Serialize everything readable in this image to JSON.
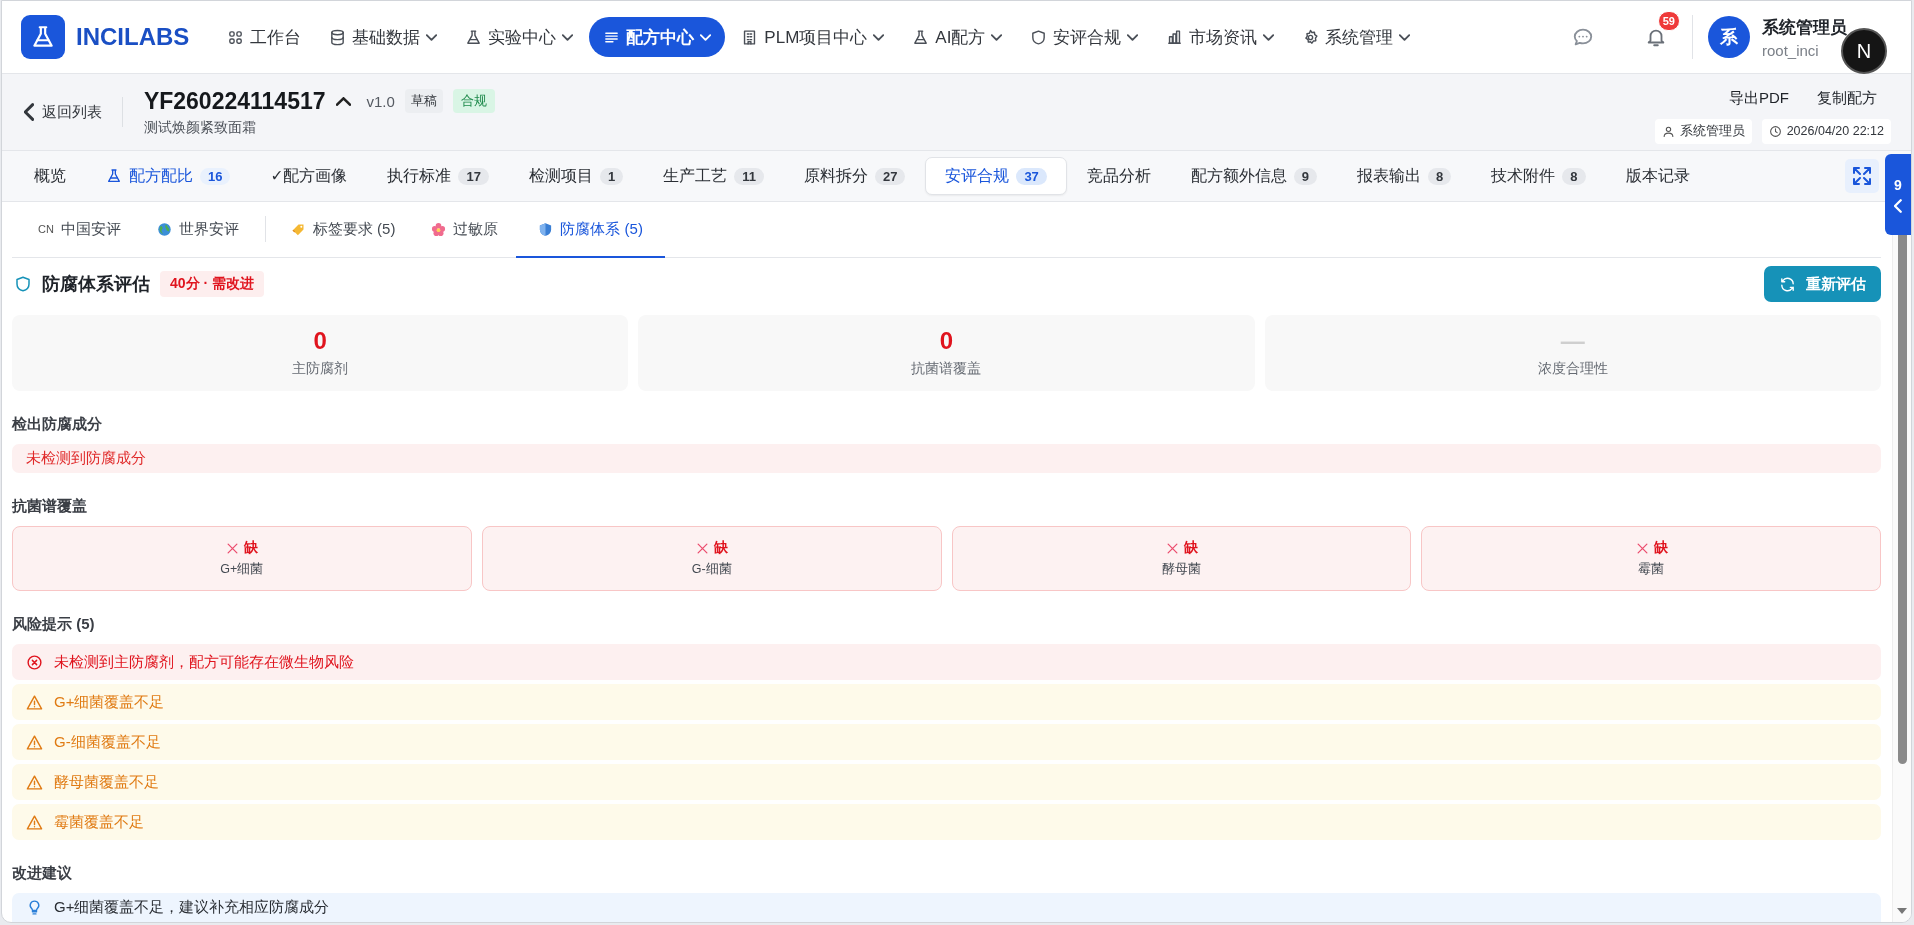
{
  "brand": {
    "name": "INCILABS"
  },
  "nav": [
    {
      "label": "工作台",
      "has_menu": false,
      "selected": false
    },
    {
      "label": "基础数据",
      "has_menu": true,
      "selected": false
    },
    {
      "label": "实验中心",
      "has_menu": true,
      "selected": false
    },
    {
      "label": "配方中心",
      "has_menu": true,
      "selected": true
    },
    {
      "label": "PLM项目中心",
      "has_menu": true,
      "selected": false
    },
    {
      "label": "AI配方",
      "has_menu": true,
      "selected": false
    },
    {
      "label": "安评合规",
      "has_menu": true,
      "selected": false
    },
    {
      "label": "市场资讯",
      "has_menu": true,
      "selected": false
    },
    {
      "label": "系统管理",
      "has_menu": true,
      "selected": false
    }
  ],
  "notifications": {
    "count": "59"
  },
  "user": {
    "avatar": "系",
    "name": "系统管理员",
    "account": "root_inci"
  },
  "floating_button": {
    "label": "N"
  },
  "formula": {
    "back": "返回列表",
    "code": "YF260224114517",
    "version": "v1.0",
    "status": "草稿",
    "compliance": "合规",
    "name": "测试焕颜紧致面霜",
    "actions": [
      "导出PDF",
      "复制配方"
    ],
    "owner": "系统管理员",
    "updated": "2026/04/20 22:12"
  },
  "tabs": [
    {
      "label": "概览",
      "selected": false,
      "highlighted": false
    },
    {
      "label": "配方配比",
      "count": "16",
      "selected": false,
      "highlighted": true
    },
    {
      "label": "✓配方画像",
      "selected": false,
      "highlighted": false
    },
    {
      "label": "执行标准",
      "count": "17",
      "selected": false,
      "highlighted": false
    },
    {
      "label": "检测项目",
      "count": "1",
      "selected": false,
      "highlighted": false
    },
    {
      "label": "生产工艺",
      "count": "11",
      "selected": false,
      "highlighted": false
    },
    {
      "label": "原料拆分",
      "count": "27",
      "selected": false,
      "highlighted": false
    },
    {
      "label": "安评合规",
      "count": "37",
      "selected": true,
      "highlighted": false
    },
    {
      "label": "竞品分析",
      "selected": false,
      "highlighted": false
    },
    {
      "label": "配方额外信息",
      "count": "9",
      "selected": false,
      "highlighted": false
    },
    {
      "label": "报表输出",
      "count": "8",
      "selected": false,
      "highlighted": false
    },
    {
      "label": "技术附件",
      "count": "8",
      "selected": false,
      "highlighted": false
    },
    {
      "label": "版本记录",
      "selected": false,
      "highlighted": false
    }
  ],
  "side_handle": {
    "count": "9"
  },
  "sub_tabs": [
    {
      "prefix": "CN",
      "label": "中国安评",
      "selected": false,
      "separated": false
    },
    {
      "label": "世界安评",
      "selected": false,
      "separated": false
    },
    {
      "label": "标签要求 (5)",
      "selected": false,
      "separated": true
    },
    {
      "label": "过敏原",
      "selected": false,
      "separated": false
    },
    {
      "label": "防腐体系 (5)",
      "selected": true,
      "separated": false
    }
  ],
  "panel": {
    "title": "防腐体系评估",
    "score": "40分 · 需改进",
    "button": "重新评估",
    "stats": [
      {
        "value": "0",
        "label": "主防腐剂",
        "kind": "alert"
      },
      {
        "value": "0",
        "label": "抗菌谱覆盖",
        "kind": "alert"
      },
      {
        "value": "—",
        "label": "浓度合理性",
        "kind": "none"
      }
    ],
    "detected": {
      "title": "检出防腐成分",
      "empty": "未检测到防腐成分"
    },
    "coverage": {
      "title": "抗菌谱覆盖",
      "items": [
        {
          "status": "缺",
          "label": "G+细菌",
          "covered": false
        },
        {
          "status": "缺",
          "label": "G-细菌",
          "covered": false
        },
        {
          "status": "缺",
          "label": "酵母菌",
          "covered": false
        },
        {
          "status": "缺",
          "label": "霉菌",
          "covered": false
        }
      ]
    },
    "risks": {
      "title": "风险提示 (5)",
      "items": [
        {
          "kind": "error",
          "text": "未检测到主防腐剂，配方可能存在微生物风险"
        },
        {
          "kind": "warning",
          "text": "G+细菌覆盖不足"
        },
        {
          "kind": "warning",
          "text": "G-细菌覆盖不足"
        },
        {
          "kind": "warning",
          "text": "酵母菌覆盖不足"
        },
        {
          "kind": "warning",
          "text": "霉菌覆盖不足"
        }
      ]
    },
    "suggestions": {
      "title": "改进建议",
      "items": [
        {
          "text": "G+细菌覆盖不足，建议补充相应防腐成分"
        }
      ]
    }
  }
}
